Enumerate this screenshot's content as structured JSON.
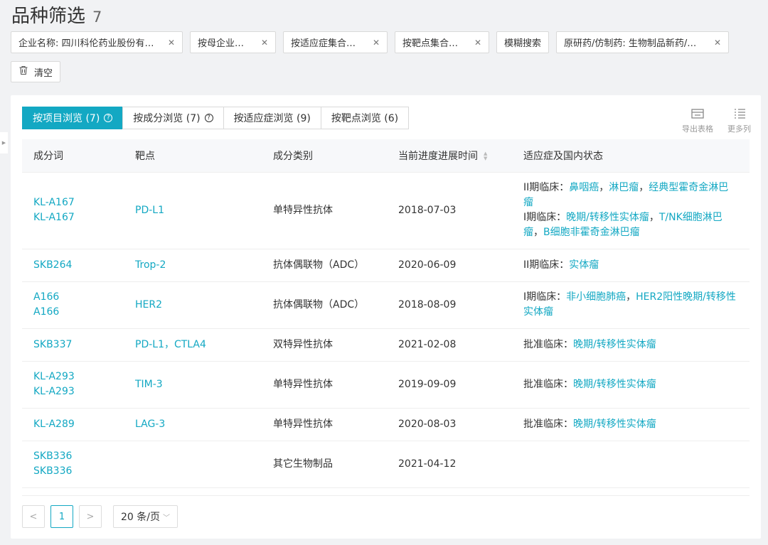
{
  "page": {
    "title": "品种筛选",
    "count": "7"
  },
  "chips": [
    {
      "label": "企业名称: 四川科伦药业股份有…",
      "closable": true,
      "width": 242
    },
    {
      "label": "按母企业搜索",
      "closable": true,
      "width": 121
    },
    {
      "label": "按适应症集合搜索",
      "closable": true,
      "width": 147
    },
    {
      "label": "按靶点集合搜索",
      "closable": true,
      "width": 133
    },
    {
      "label": "模糊搜索",
      "closable": false,
      "width": 74
    },
    {
      "label": "原研药/仿制药: 生物制品新药/原…",
      "closable": true,
      "width": 243
    }
  ],
  "clear_label": "清空",
  "tabs": [
    {
      "label": "按项目浏览 (7)",
      "help": true,
      "active": true
    },
    {
      "label": "按成分浏览 (7)",
      "help": true,
      "active": false
    },
    {
      "label": "按适应症浏览 (9)",
      "help": false,
      "active": false
    },
    {
      "label": "按靶点浏览 (6)",
      "help": false,
      "active": false
    }
  ],
  "tools": {
    "export_label": "导出表格",
    "more_label": "更多列"
  },
  "table": {
    "headers": [
      "成分词",
      "靶点",
      "成分类别",
      "当前进度进展时间",
      "适应症及国内状态"
    ],
    "rows": [
      {
        "names": [
          "KL-A167",
          "KL-A167"
        ],
        "target": "PD-L1",
        "category": "单特异性抗体",
        "date": "2018-07-03",
        "status": [
          {
            "prefix": "II期临床：",
            "items": [
              "鼻咽癌",
              "淋巴瘤",
              "经典型霍奇金淋巴瘤"
            ]
          },
          {
            "prefix": "I期临床：",
            "items": [
              "晚期/转移性实体瘤",
              "T/NK细胞淋巴瘤",
              "B细胞非霍奇金淋巴瘤"
            ]
          }
        ]
      },
      {
        "names": [
          "SKB264"
        ],
        "target": "Trop-2",
        "category": "抗体偶联物（ADC）",
        "date": "2020-06-09",
        "status": [
          {
            "prefix": "II期临床：",
            "items": [
              "实体瘤"
            ]
          }
        ]
      },
      {
        "names": [
          "A166",
          "A166"
        ],
        "target": "HER2",
        "category": "抗体偶联物（ADC）",
        "date": "2018-08-09",
        "status": [
          {
            "prefix": "I期临床：",
            "items": [
              "非小细胞肺癌",
              "HER2阳性晚期/转移性实体瘤"
            ]
          }
        ]
      },
      {
        "names": [
          "SKB337"
        ],
        "target": "PD-L1，CTLA4",
        "category": "双特异性抗体",
        "date": "2021-02-08",
        "status": [
          {
            "prefix": "批准临床：",
            "items": [
              "晚期/转移性实体瘤"
            ]
          }
        ]
      },
      {
        "names": [
          "KL-A293",
          "KL-A293"
        ],
        "target": "TIM-3",
        "category": "单特异性抗体",
        "date": "2019-09-09",
        "status": [
          {
            "prefix": "批准临床：",
            "items": [
              "晚期/转移性实体瘤"
            ]
          }
        ]
      },
      {
        "names": [
          "KL-A289"
        ],
        "target": "LAG-3",
        "category": "单特异性抗体",
        "date": "2020-08-03",
        "status": [
          {
            "prefix": "批准临床：",
            "items": [
              "晚期/转移性实体瘤"
            ]
          }
        ]
      },
      {
        "names": [
          "SKB336",
          "SKB336"
        ],
        "target": "",
        "category": "其它生物制品",
        "date": "2021-04-12",
        "status": []
      }
    ]
  },
  "pager": {
    "prev": "<",
    "current": "1",
    "next": ">",
    "page_size": "20 条/页"
  },
  "colors": {
    "accent": "#13a8c3"
  }
}
